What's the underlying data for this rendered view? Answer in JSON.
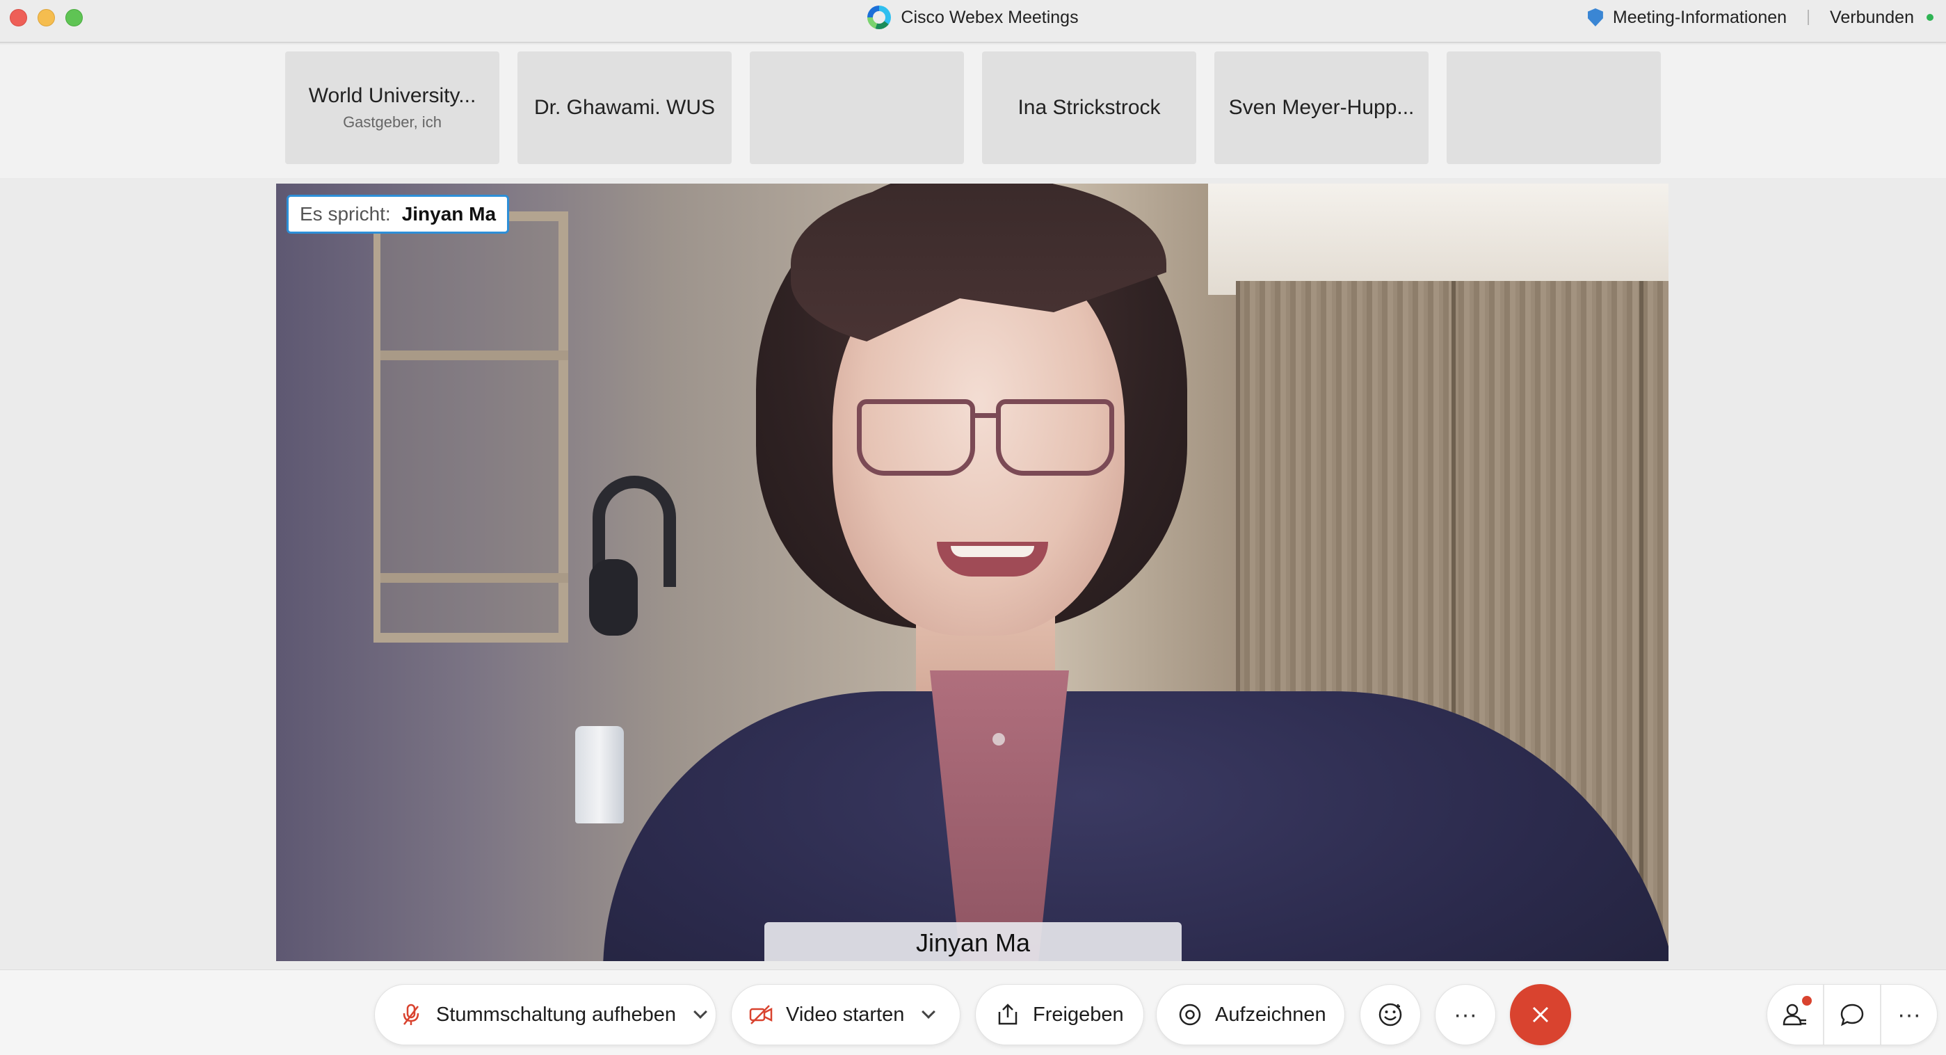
{
  "window": {
    "title": "Cisco Webex Meetings",
    "meeting_info": "Meeting-Informationen",
    "connection_status": "Verbunden"
  },
  "participants": [
    {
      "name": "World University...",
      "sub": "Gastgeber, ich"
    },
    {
      "name": "Dr. Ghawami. WUS",
      "sub": ""
    },
    {
      "name": "",
      "sub": ""
    },
    {
      "name": "Ina Strickstrock",
      "sub": ""
    },
    {
      "name": "Sven Meyer-Hupp...",
      "sub": ""
    },
    {
      "name": "",
      "sub": ""
    }
  ],
  "stage": {
    "speaking_label": "Es spricht:",
    "speaking_name": "Jinyan Ma",
    "video_name": "Jinyan Ma"
  },
  "toolbar": {
    "unmute_label": "Stummschaltung aufheben",
    "video_label": "Video starten",
    "share_label": "Freigeben",
    "record_label": "Aufzeichnen",
    "more_label": "···"
  },
  "colors": {
    "leave": "#d9432f",
    "accent": "#2d8fd8",
    "connected": "#2fb454",
    "muted_icon": "#d9432f"
  }
}
